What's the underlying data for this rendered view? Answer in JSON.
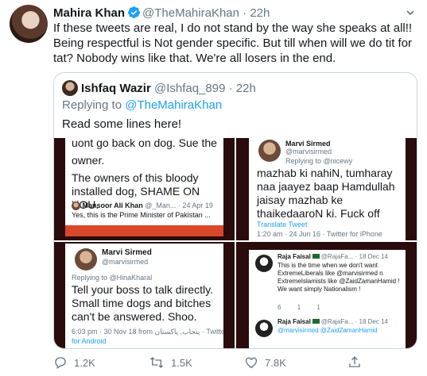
{
  "tweet": {
    "author_name": "Mahira Khan",
    "author_handle": "@TheMahiraKhan",
    "separator": "·",
    "time": "22h",
    "text": "If these tweets are real, I do not stand by the way she speaks at all!! Being respectful is Not gender specific. But till when will we do tit for tat? Nobody wins like that. We're all losers in the end."
  },
  "quote": {
    "author_name": "Ishfaq Wazir",
    "author_handle": "@Ishfaq_899",
    "separator": "·",
    "time": "22h",
    "replying_prefix": "Replying to",
    "replying_to": "@TheMahiraKhan",
    "text": "Read some lines here!"
  },
  "images": {
    "img1": {
      "line1": "uont go back on dog. Sue the",
      "line2": "owner.",
      "line3": "The owners of this bloody installed dog, SHAME ON YOU.",
      "meta_name": "Mansoor Ali Khan",
      "meta_handle": "@_Man...",
      "meta_sep": "·",
      "meta_date": "24 Apr 19",
      "sub": "Yes, this is the Prime Minister of Pakistan ..."
    },
    "img2": {
      "name": "Marvi Sirmed",
      "handle": "@marvisirmed",
      "reply": "Replying to @nicewy",
      "text": "mazhab ki nahiN, tumharay naa jaayez baap Hamdullah jaisay mazhab ke thaikedaaroN ki. Fuck off",
      "translate": "Translate Tweet",
      "meta": "1:20 am · 24 Jun 16 · Twitter for iPhone"
    },
    "img3": {
      "name": "Marvi Sirmed",
      "handle": "@marvisirmed",
      "reply": "Replying to @HinaKharal",
      "text": "Tell your boss to talk directly. Small time dogs and bitches can't be answered. Shoo.",
      "meta": "6:03 pm · 30 Nov 18 from پنجاب, پاکستان · Twitter",
      "android": "for Android"
    },
    "img4": {
      "name": "Raja Faisal",
      "handle": "@RajaFa...",
      "sep": "·",
      "date": "18 Dec 14",
      "body": "This is the time when we don't want ExtremeLiberals like @marvisirmed n ExtremeIslamists like @ZaidZamanHamid ! We want simply Nationalism !",
      "reply_count": "6",
      "rt_count": "1",
      "like_count": "1",
      "name2": "Raja Faisal",
      "handle2": "@RajaFa...",
      "date2": "18 Dec 14",
      "body2": "@marvisirmed @ZaidZamanHamid"
    }
  },
  "actions": {
    "reply_count": "1.2K",
    "retweet_count": "1.5K",
    "like_count": "7.8K"
  },
  "colors": {
    "accent": "#1da1f2",
    "muted": "#657786",
    "border": "#ccd6dd"
  },
  "icons": [
    "verified-badge-icon",
    "caret-down-icon",
    "reply-icon",
    "retweet-icon",
    "like-icon",
    "share-icon"
  ]
}
